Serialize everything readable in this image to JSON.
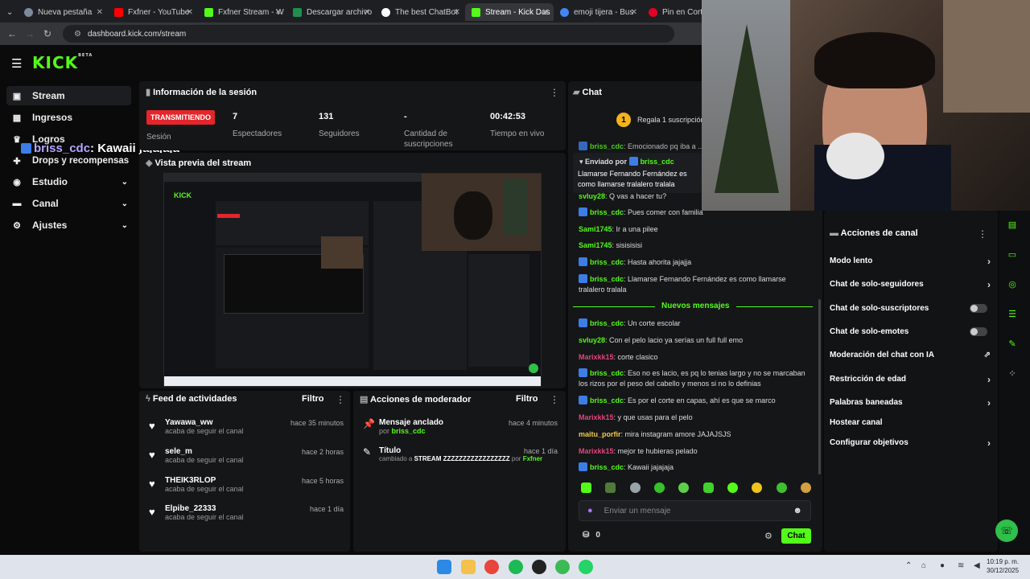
{
  "browser": {
    "tabs": [
      {
        "title": "Nueva pestaña",
        "color": "#7c8aa0"
      },
      {
        "title": "Fxfner - YouTube",
        "color": "#ff0000"
      },
      {
        "title": "Fxfner Stream - W",
        "color": "#53fc18"
      },
      {
        "title": "Descargar archivo",
        "color": "#1e8f4d"
      },
      {
        "title": "The best ChatBot",
        "color": "#ffffff"
      },
      {
        "title": "Stream - Kick Das",
        "color": "#53fc18"
      },
      {
        "title": "emoji tijera - Bus",
        "color": "#4285f4"
      },
      {
        "title": "Pin en Cortes",
        "color": "#e60023"
      }
    ],
    "url": "dashboard.kick.com/stream"
  },
  "brand": {
    "logo": "KICK",
    "beta": "BETA",
    "accent": "#53fc18"
  },
  "sidebar": {
    "items": [
      {
        "label": "Stream",
        "icon": "tv-icon"
      },
      {
        "label": "Ingresos",
        "icon": "money-icon"
      },
      {
        "label": "Logros",
        "icon": "trophy-icon"
      },
      {
        "label": "Drops y recompensas",
        "icon": "gift-icon"
      },
      {
        "label": "Estudio",
        "icon": "camera-icon"
      },
      {
        "label": "Canal",
        "icon": "channel-icon"
      },
      {
        "label": "Ajustes",
        "icon": "gear-icon"
      }
    ]
  },
  "overlay_chat": {
    "user": "briss_cdc",
    "text": ": Kawaii jajajaja"
  },
  "session": {
    "title": "Información de la sesión",
    "status": "TRANSMITIENDO",
    "status_label": "Sesión",
    "stats": [
      {
        "value": "7",
        "label": "Espectadores"
      },
      {
        "value": "131",
        "label": "Seguidores"
      },
      {
        "value": "-",
        "label": "Cantidad de suscripciones"
      },
      {
        "value": "00:42:53",
        "label": "Tiempo en vivo"
      }
    ]
  },
  "preview": {
    "title": "Vista previa del stream"
  },
  "feed": {
    "title": "Feed de actividades",
    "filter": "Filtro",
    "items": [
      {
        "user": "Yawawa_ww",
        "action": "acaba de seguir el canal",
        "time": "hace 35 minutos"
      },
      {
        "user": "sele_m",
        "action": "acaba de seguir el canal",
        "time": "hace 2 horas"
      },
      {
        "user": "THEIK3RLOP",
        "action": "acaba de seguir el canal",
        "time": "hace 5 horas"
      },
      {
        "user": "Elpibe_22333",
        "action": "acaba de seguir el canal",
        "time": "hace 1 día"
      }
    ]
  },
  "modactions": {
    "title": "Acciones de moderador",
    "filter": "Filtro",
    "items": [
      {
        "title": "Mensaje anclado",
        "prefix": "por",
        "user": "briss_cdc",
        "time": "hace 4 minutos"
      },
      {
        "title": "Título",
        "prefix": "cambiado a",
        "value": "STREAM ZZZZZZZZZZZZZZZZZ",
        "by": "por",
        "user": "Fxfner",
        "time": "hace 1 día"
      }
    ]
  },
  "chat": {
    "title": "Chat",
    "gift": "Regala 1 suscripción",
    "pinned_by_label": "Enviado por",
    "pinned_user": "briss_cdc",
    "pinned_text": "Llamarse Fernando Fernández es como llamarse tralalero tralala",
    "new_messages": "Nuevos mensajes",
    "messages": [
      {
        "user": "briss_cdc",
        "text": ": Emocionado pq iba a ...",
        "color": "#53fc18",
        "badge": true
      },
      {
        "user": "svluy28",
        "text": ": Q vas a hacer tu?",
        "color": "#53fc18",
        "badge": false
      },
      {
        "user": "briss_cdc",
        "text": ": Pues comer con familia",
        "color": "#53fc18",
        "badge": true
      },
      {
        "user": "Sami1745",
        "text": ": Ir a una pilee",
        "color": "#53fc18",
        "badge": false
      },
      {
        "user": "Sami1745",
        "text": ": sisisisisi",
        "color": "#53fc18",
        "badge": false
      },
      {
        "user": "briss_cdc",
        "text": ": Hasta ahorita jajajja",
        "color": "#53fc18",
        "badge": true
      },
      {
        "user": "briss_cdc",
        "text": ": Llamarse Fernando Fernández es como llamarse tralalero tralala",
        "color": "#53fc18",
        "badge": true
      },
      {
        "user": "briss_cdc",
        "text": ": Un corte escolar",
        "color": "#53fc18",
        "badge": true
      },
      {
        "user": "svluy28",
        "text": ": Con el pelo lacio ya serías un full full emo",
        "color": "#53fc18",
        "badge": false
      },
      {
        "user": "Marixkk15",
        "text": ": corte clasico",
        "color": "#e0457b",
        "badge": false
      },
      {
        "user": "briss_cdc",
        "text": ": Eso no es lacio, es pq lo tenias largo y no se marcaban los rizos por el peso del cabello y menos si no lo definias",
        "color": "#53fc18",
        "badge": true
      },
      {
        "user": "briss_cdc",
        "text": ": Es por el corte en capas, ahí es que se marco",
        "color": "#53fc18",
        "badge": true
      },
      {
        "user": "Marixkk15",
        "text": ": y que usas para el pelo",
        "color": "#e0457b",
        "badge": false
      },
      {
        "user": "maitu_porfir",
        "text": ": mira instagram amore JAJAJSJS",
        "color": "#f2c94c",
        "badge": false
      },
      {
        "user": "Marixkk15",
        "text": ": mejor te hubieras pelado",
        "color": "#e0457b",
        "badge": false
      },
      {
        "user": "briss_cdc",
        "text": ": Kawaii jajajaja",
        "color": "#53fc18",
        "badge": true
      }
    ],
    "input_placeholder": "Enviar un mensaje",
    "points": "0",
    "send_label": "Chat"
  },
  "channel_actions": {
    "title": "Acciones de canal",
    "items": [
      {
        "label": "Modo lento",
        "control": "arrow"
      },
      {
        "label": "Chat de solo-seguidores",
        "control": "arrow"
      },
      {
        "label": "Chat de solo-suscriptores",
        "control": "toggle"
      },
      {
        "label": "Chat de solo-emotes",
        "control": "toggle"
      },
      {
        "label": "Moderación del chat con IA",
        "control": "external"
      },
      {
        "label": "Restricción de edad",
        "control": "arrow"
      },
      {
        "label": "Palabras baneadas",
        "control": "arrow"
      },
      {
        "label": "Hostear canal",
        "control": "none"
      },
      {
        "label": "Configurar objetivos",
        "control": "arrow"
      }
    ]
  },
  "clock": {
    "time": "10:19 p. m.",
    "date": "30/12/2025"
  }
}
